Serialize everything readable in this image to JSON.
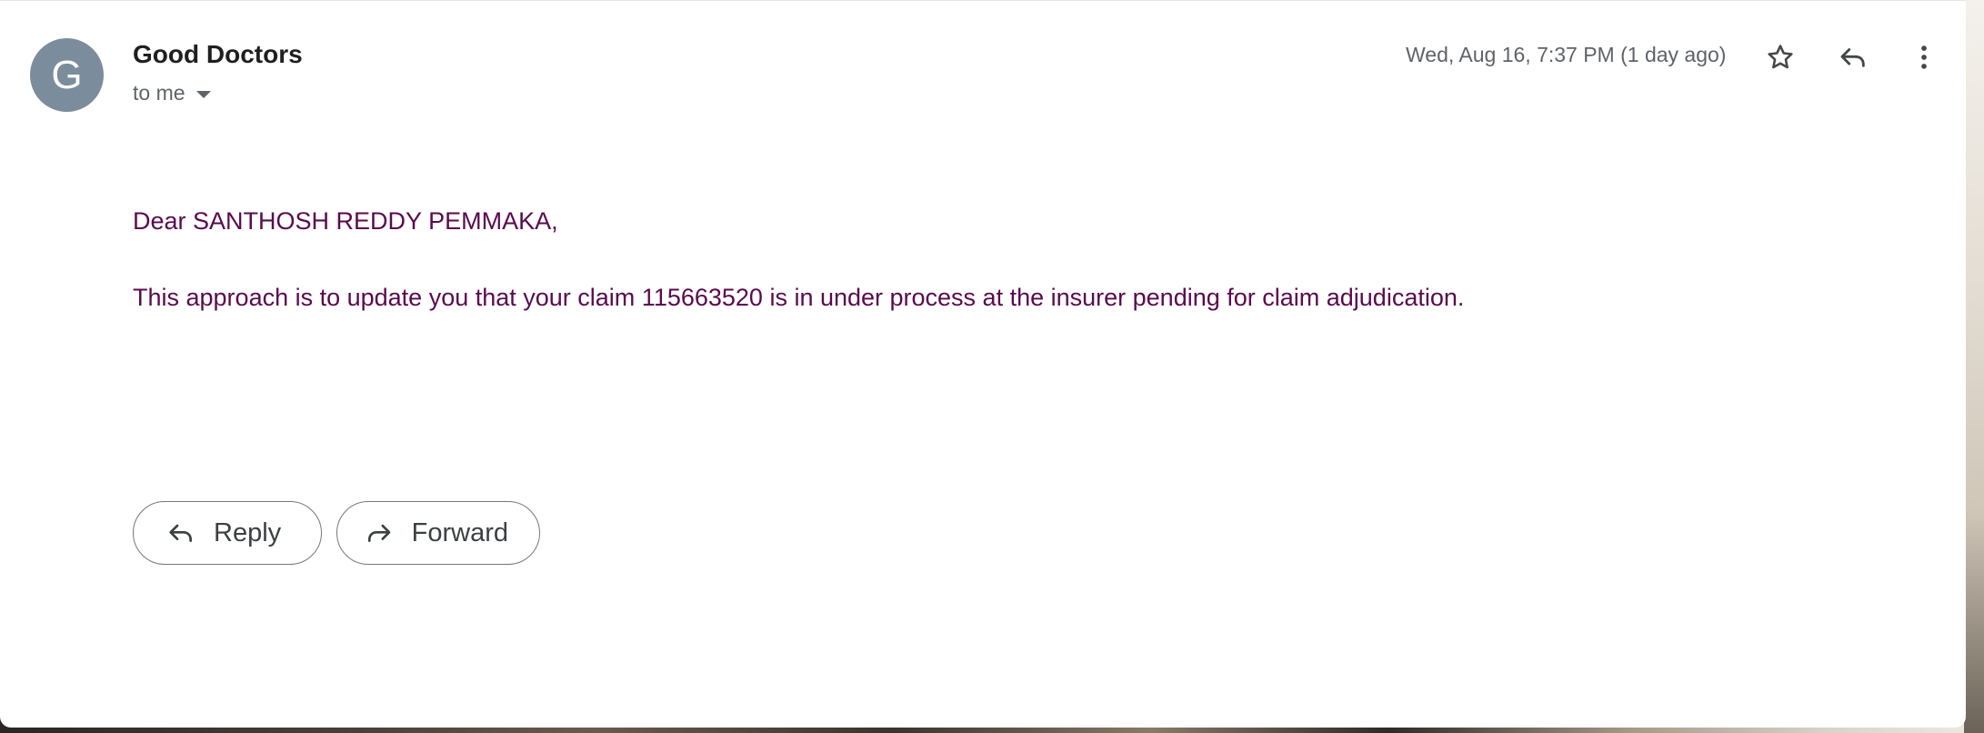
{
  "email": {
    "avatar_letter": "G",
    "sender_name": "Good Doctors",
    "recipient_label": "to me",
    "date": "Wed, Aug 16, 7:37 PM (1 day ago)",
    "greeting": "Dear SANTHOSH REDDY PEMMAKA,",
    "message": "This approach is to update you that your claim 115663520 is in under process at the insurer pending for claim adjudication."
  },
  "actions": {
    "reply_label": "Reply",
    "forward_label": "Forward"
  },
  "icons": {
    "star": "star-icon",
    "reply": "reply-icon",
    "more": "more-vertical-icon",
    "dropdown": "caret-down-icon",
    "forward": "forward-icon"
  },
  "colors": {
    "avatar_bg": "#7b8d9c",
    "body_text": "#5a0a4e",
    "meta_text": "#5f6368"
  }
}
